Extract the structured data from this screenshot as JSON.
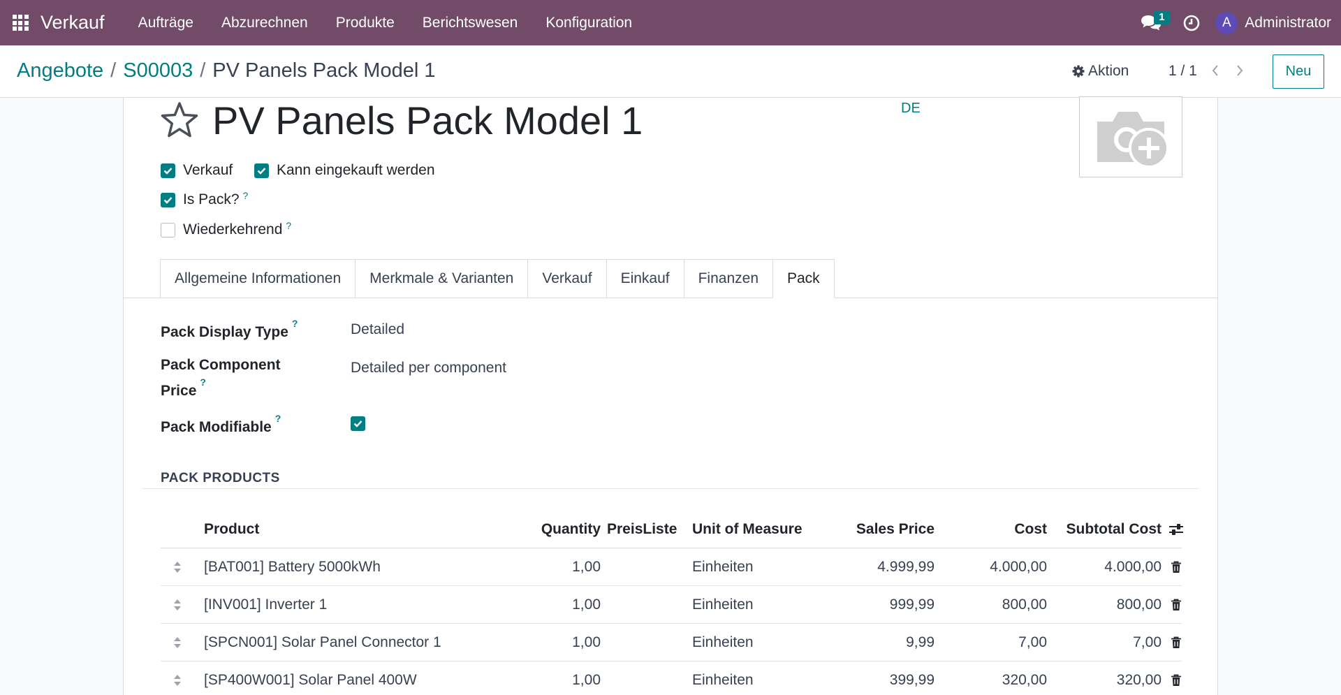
{
  "navbar": {
    "brand": "Verkauf",
    "menu": [
      "Aufträge",
      "Abzurechnen",
      "Produkte",
      "Berichtswesen",
      "Konfiguration"
    ],
    "chat_count": "1",
    "avatar_initial": "A",
    "user": "Administrator",
    "color": "#714b67"
  },
  "breadcrumb": {
    "items": [
      "Angebote",
      "S00003"
    ],
    "separator": "/",
    "current": "PV Panels Pack Model 1"
  },
  "control": {
    "action_label": "Aktion",
    "pager": "1 / 1",
    "new_label": "Neu"
  },
  "product": {
    "title": "PV Panels Pack Model 1",
    "lang": "DE",
    "checkboxes": [
      {
        "label": "Verkauf",
        "checked": true
      },
      {
        "label": "Kann eingekauft werden",
        "checked": true
      },
      {
        "label": "Is Pack?",
        "checked": true,
        "help": "?"
      },
      {
        "label": "Wiederkehrend",
        "checked": false,
        "help": "?"
      }
    ]
  },
  "tabs": [
    "Allgemeine Informationen",
    "Merkmale & Varianten",
    "Verkauf",
    "Einkauf",
    "Finanzen",
    "Pack"
  ],
  "active_tab": "Pack",
  "pack": {
    "display_type_label": "Pack Display Type",
    "display_type_value": "Detailed",
    "component_price_label_1": "Pack Component",
    "component_price_label_2": "Price",
    "component_price_value": "Detailed per component",
    "modifiable_label": "Pack Modifiable",
    "modifiable_checked": true,
    "help": "?"
  },
  "pack_products": {
    "title": "PACK PRODUCTS",
    "columns": [
      "Product",
      "Quantity",
      "PreisListe",
      "Unit of Measure",
      "Sales Price",
      "Cost",
      "Subtotal Cost"
    ],
    "rows": [
      {
        "product": "[BAT001] Battery 5000kWh",
        "qty": "1,00",
        "pricelist": "",
        "uom": "Einheiten",
        "sales": "4.999,99",
        "cost": "4.000,00",
        "subtotal": "4.000,00"
      },
      {
        "product": "[INV001] Inverter 1",
        "qty": "1,00",
        "pricelist": "",
        "uom": "Einheiten",
        "sales": "999,99",
        "cost": "800,00",
        "subtotal": "800,00"
      },
      {
        "product": "[SPCN001] Solar Panel Connector 1",
        "qty": "1,00",
        "pricelist": "",
        "uom": "Einheiten",
        "sales": "9,99",
        "cost": "7,00",
        "subtotal": "7,00"
      },
      {
        "product": "[SP400W001] Solar Panel 400W",
        "qty": "1,00",
        "pricelist": "",
        "uom": "Einheiten",
        "sales": "399,99",
        "cost": "320,00",
        "subtotal": "320,00"
      }
    ]
  },
  "accent_color": "#017e84"
}
